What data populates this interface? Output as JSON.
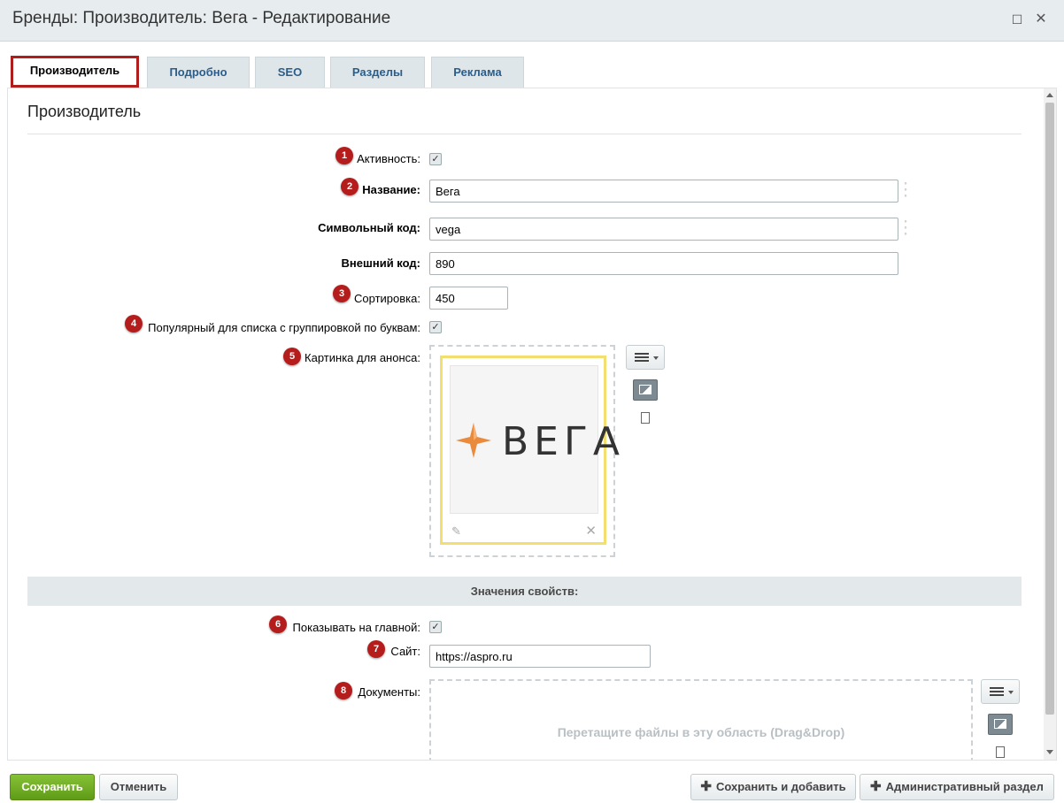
{
  "window": {
    "title": "Бренды: Производитель: Вега - Редактирование"
  },
  "tabs": [
    {
      "label": "Производитель",
      "active": true
    },
    {
      "label": "Подробно"
    },
    {
      "label": "SEO"
    },
    {
      "label": "Разделы"
    },
    {
      "label": "Реклама"
    }
  ],
  "section": {
    "title": "Производитель"
  },
  "fields": {
    "active": {
      "badge": "1",
      "label": "Активность:",
      "checked": true
    },
    "name": {
      "badge": "2",
      "label": "Название:",
      "value": "Вега"
    },
    "code": {
      "label": "Символьный код:",
      "value": "vega"
    },
    "external_code": {
      "label": "Внешний код:",
      "value": "890"
    },
    "sort": {
      "badge": "3",
      "label": "Сортировка:",
      "value": "450"
    },
    "popular": {
      "badge": "4",
      "label": "Популярный для списка с группировкой по буквам:",
      "checked": true
    },
    "preview_image": {
      "badge": "5",
      "label": "Картинка для анонса:",
      "logo_text": "ВЕГА"
    }
  },
  "properties": {
    "header": "Значения свойств:",
    "show_on_main": {
      "badge": "6",
      "label": "Показывать на главной:",
      "checked": true
    },
    "site": {
      "badge": "7",
      "label": "Сайт:",
      "value": "https://aspro.ru"
    },
    "documents": {
      "badge": "8",
      "label": "Документы:",
      "dropzone_hint": "Перетащите файлы в эту область (Drag&Drop)"
    }
  },
  "footer": {
    "save": "Сохранить",
    "cancel": "Отменить",
    "save_and_add": "Сохранить и добавить",
    "admin_section": "Административный раздел"
  },
  "colors": {
    "badge": "#b51c1c",
    "active_tab_border": "#b01d1d",
    "save_button": "#6aa61f",
    "image_frame": "#f2df6f",
    "tab_text": "#2a5d8c"
  },
  "icons": [
    "maximize-icon",
    "close-icon",
    "link-icon",
    "menu-icon",
    "image-icon",
    "file-icon",
    "pencil-icon",
    "delete-icon",
    "plus-icon",
    "star-logo-icon"
  ]
}
